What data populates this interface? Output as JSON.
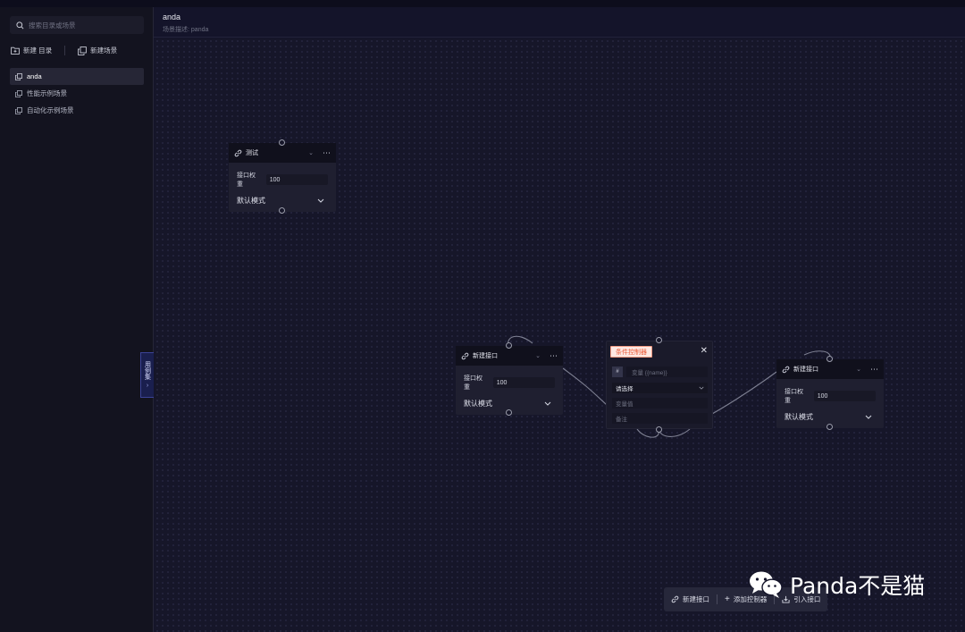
{
  "sidebar": {
    "search_placeholder": "搜索目录或场景",
    "new_dir_label": "新建 目录",
    "new_scene_label": "新建场景",
    "tree": [
      {
        "label": "anda",
        "active": true
      },
      {
        "label": "性能示例场景",
        "active": false
      },
      {
        "label": "自动化示例场景",
        "active": false
      }
    ]
  },
  "header": {
    "title": "anda",
    "desc_label": "场景描述:",
    "desc_value": "panda"
  },
  "side_tab": {
    "label": "用例集",
    "chevron": "›"
  },
  "nodes": [
    {
      "name": "测试",
      "weight_label": "接口权重",
      "weight": "100",
      "mode": "默认模式"
    },
    {
      "name": "新建接口",
      "weight_label": "接口权重",
      "weight": "100",
      "mode": "默认模式"
    },
    {
      "name": "新建接口",
      "weight_label": "接口权重",
      "weight": "100",
      "mode": "默认模式"
    }
  ],
  "condition": {
    "badge": "条件控制器",
    "var_symbol": "#",
    "var_placeholder": "变量 {{name}}",
    "select_label": "请选择",
    "value_placeholder": "变量值",
    "note_placeholder": "备注"
  },
  "toolbar": {
    "new_api_label": "新建接口",
    "add_controller_label": "添加控制器",
    "import_api_label": "引入接口"
  },
  "watermark": {
    "text": "Panda不是猫"
  },
  "colors": {
    "accent_badge_text": "#ea5a37",
    "accent_badge_bg": "#fde8e2",
    "side_tab_bg": "#1a1f4e"
  }
}
